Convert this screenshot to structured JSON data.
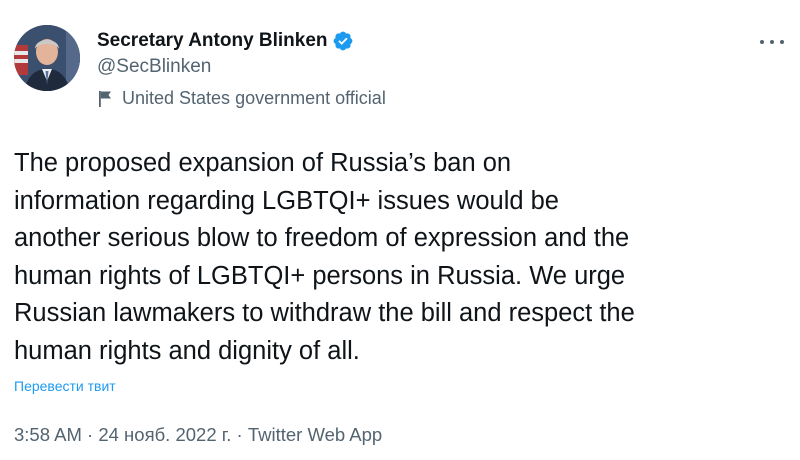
{
  "author": {
    "display_name": "Secretary Antony Blinken",
    "handle": "@SecBlinken",
    "label": "United States government official",
    "verified_icon": "verified-badge-icon",
    "label_icon": "flag-icon"
  },
  "tweet": {
    "lines": [
      "The proposed expansion of Russia’s ban on",
      "information regarding LGBTQI+ issues would be",
      "another serious blow to freedom of expression and the",
      "human rights of LGBTQI+ persons in Russia. We urge",
      "Russian lawmakers to withdraw the bill and respect the",
      "human rights and dignity of all."
    ],
    "translate_label": "Перевести твит"
  },
  "meta": {
    "time": "3:58 AM",
    "separator": " · ",
    "date": "24 нояб. 2022 г.",
    "source": "Twitter Web App"
  },
  "colors": {
    "text": "#0f1419",
    "secondary": "#536471",
    "link": "#1d9bf0",
    "verified": "#1d9bf0"
  }
}
